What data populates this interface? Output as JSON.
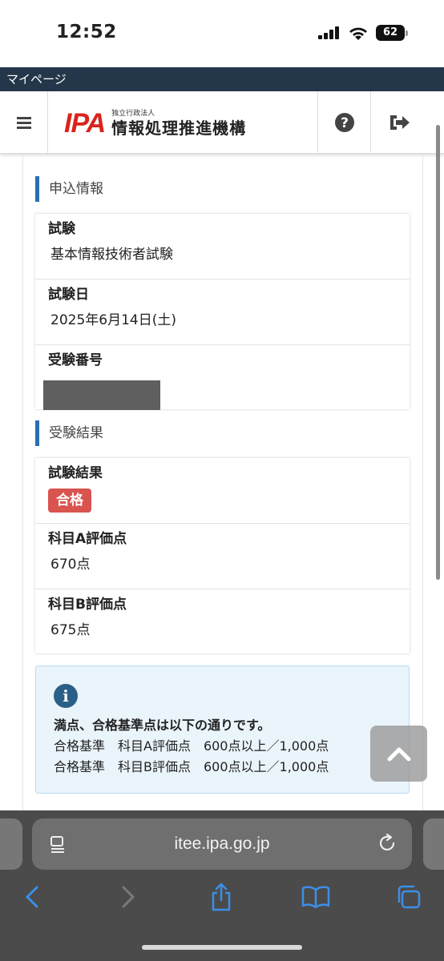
{
  "status_bar": {
    "time": "12:52",
    "battery": "62"
  },
  "page_strip": {
    "label": "マイページ"
  },
  "header": {
    "logo_mark": "IPA",
    "logo_small": "独立行政法人",
    "logo_name": "情報処理推進機構"
  },
  "application_section": {
    "title": "申込情報",
    "rows": [
      {
        "label": "試験",
        "value": "基本情報技術者試験"
      },
      {
        "label": "試験日",
        "value": "2025年6月14日(土)"
      },
      {
        "label": "受験番号",
        "value": ""
      }
    ]
  },
  "result_section": {
    "title": "受験結果",
    "result_label": "試験結果",
    "result_badge": "合格",
    "rows": [
      {
        "label": "科目A評価点",
        "value": "670点"
      },
      {
        "label": "科目B評価点",
        "value": "675点"
      }
    ]
  },
  "info": {
    "heading": "満点、合格基準点は以下の通りです。",
    "lines": [
      "合格基準　科目A評価点　600点以上／1,000点",
      "合格基準　科目B評価点　600点以上／1,000点"
    ]
  },
  "browser": {
    "url": "itee.ipa.go.jp"
  },
  "colors": {
    "accent": "#2a6fb5",
    "brand": "#d9231c",
    "pass_badge": "#d9534f",
    "nav_bar": "#24374a"
  }
}
